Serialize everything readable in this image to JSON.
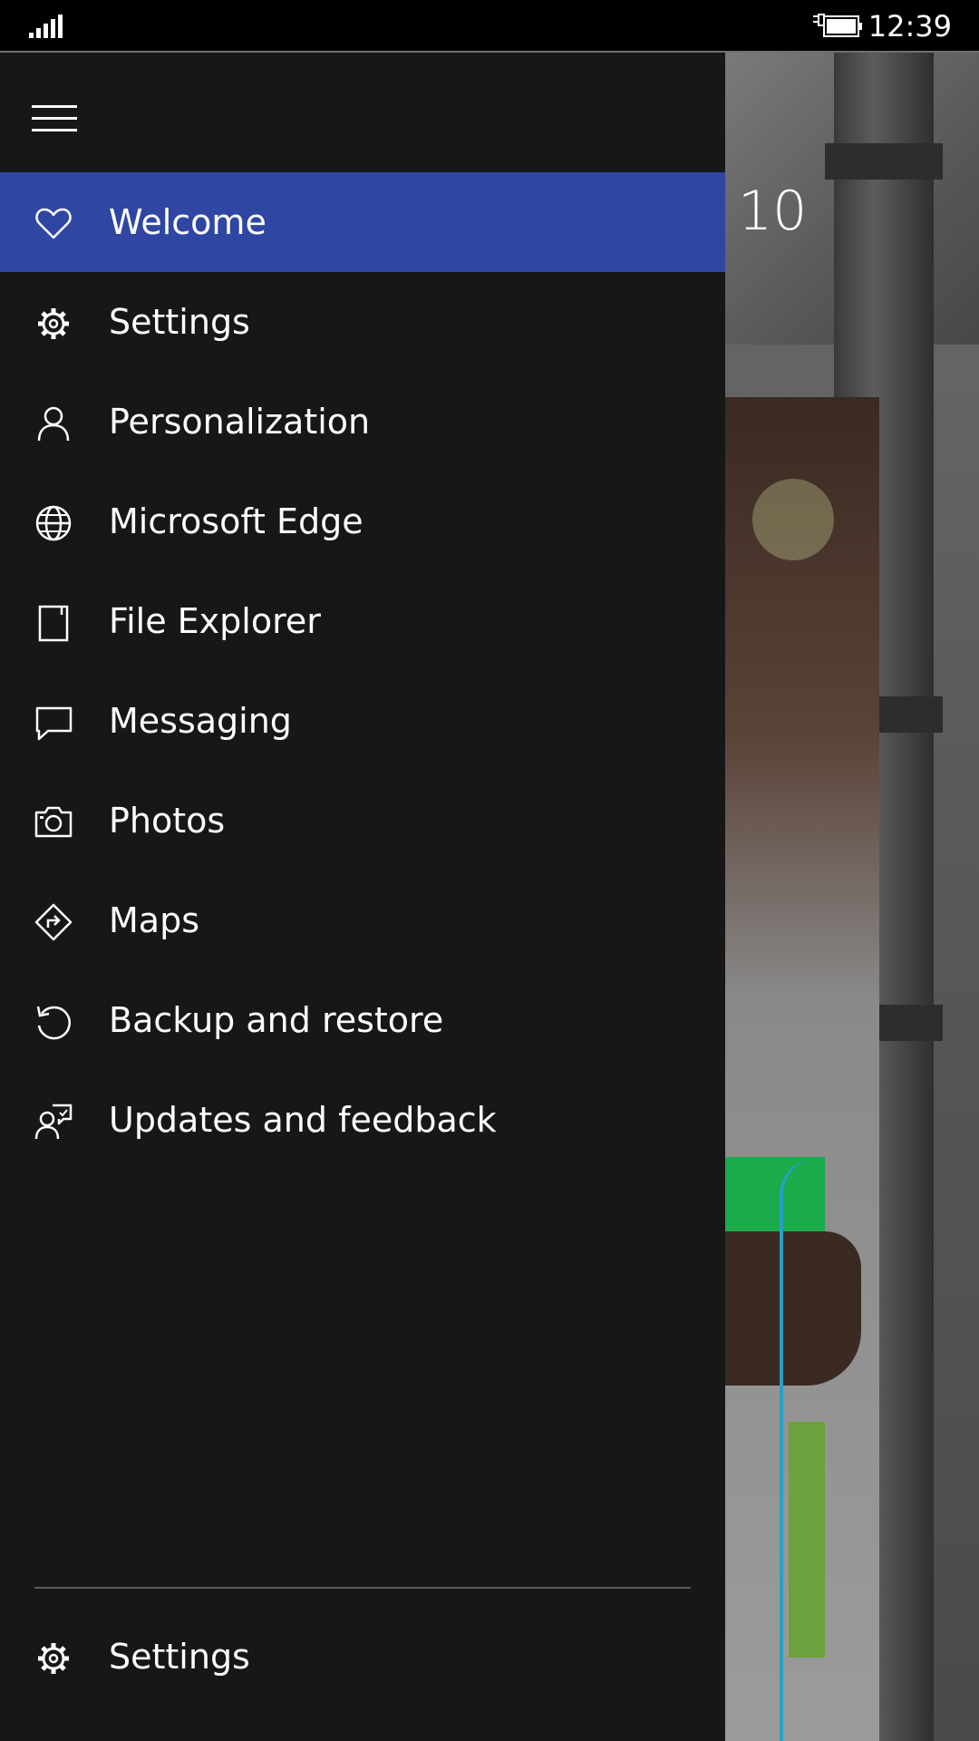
{
  "status_bar": {
    "time": "12:39",
    "signal_icon": "signal-strength-icon",
    "battery_icon": "battery-charging-icon"
  },
  "background": {
    "partial_title": "10"
  },
  "nav": {
    "menu_icon": "hamburger-icon",
    "items": [
      {
        "label": "Welcome",
        "icon": "heart-icon",
        "selected": true
      },
      {
        "label": "Settings",
        "icon": "gear-icon",
        "selected": false
      },
      {
        "label": "Personalization",
        "icon": "person-icon",
        "selected": false
      },
      {
        "label": "Microsoft Edge",
        "icon": "globe-icon",
        "selected": false
      },
      {
        "label": "File Explorer",
        "icon": "file-icon",
        "selected": false
      },
      {
        "label": "Messaging",
        "icon": "chat-bubble-icon",
        "selected": false
      },
      {
        "label": "Photos",
        "icon": "camera-icon",
        "selected": false
      },
      {
        "label": "Maps",
        "icon": "directions-icon",
        "selected": false
      },
      {
        "label": "Backup and restore",
        "icon": "restore-icon",
        "selected": false
      },
      {
        "label": "Updates and feedback",
        "icon": "feedback-icon",
        "selected": false
      }
    ],
    "bottom": {
      "label": "Settings",
      "icon": "gear-icon"
    }
  },
  "colors": {
    "accent": "#2f46a3",
    "pane_background": "#171717",
    "status_background": "#000000"
  }
}
